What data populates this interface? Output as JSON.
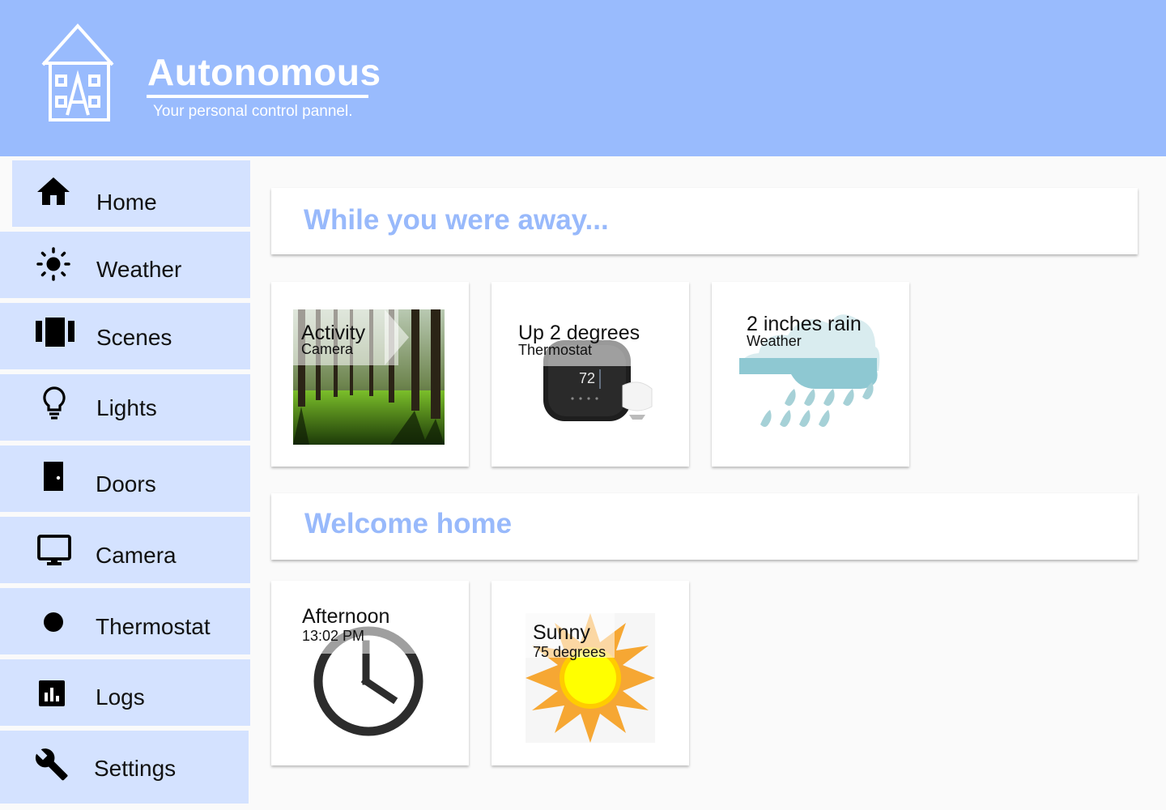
{
  "header": {
    "title": "Autonomous",
    "subtitle": "Your personal control pannel."
  },
  "sidebar": {
    "items": [
      {
        "label": "Home",
        "icon": "home-icon",
        "active": true
      },
      {
        "label": "Weather",
        "icon": "sun-icon"
      },
      {
        "label": "Scenes",
        "icon": "scenes-icon"
      },
      {
        "label": "Lights",
        "icon": "lightbulb-icon"
      },
      {
        "label": "Doors",
        "icon": "door-icon"
      },
      {
        "label": "Camera",
        "icon": "monitor-icon"
      },
      {
        "label": "Thermostat",
        "icon": "dot-icon"
      },
      {
        "label": "Logs",
        "icon": "chart-icon"
      },
      {
        "label": "Settings",
        "icon": "wrench-icon"
      }
    ]
  },
  "sections": [
    {
      "title": "While you were away...",
      "cards": [
        {
          "title": "Activity",
          "subtitle": "Camera",
          "image": "forest-photo"
        },
        {
          "title": "Up 2 degrees",
          "subtitle": "Thermostat",
          "image": "thermostat-photo",
          "display_value": "72"
        },
        {
          "title": "2 inches rain",
          "subtitle": "Weather",
          "image": "rain-cloud-illustration"
        }
      ]
    },
    {
      "title": "Welcome home",
      "cards": [
        {
          "title": "Afternoon",
          "subtitle": "13:02 PM",
          "image": "clock-illustration"
        },
        {
          "title": "Sunny",
          "subtitle": "75 degrees",
          "image": "sun-illustration"
        }
      ]
    }
  ],
  "colors": {
    "header_bg": "#99bbfd",
    "nav_bg": "#d4e2ff",
    "section_title": "#98b9fb",
    "page_bg": "#fafafa"
  }
}
